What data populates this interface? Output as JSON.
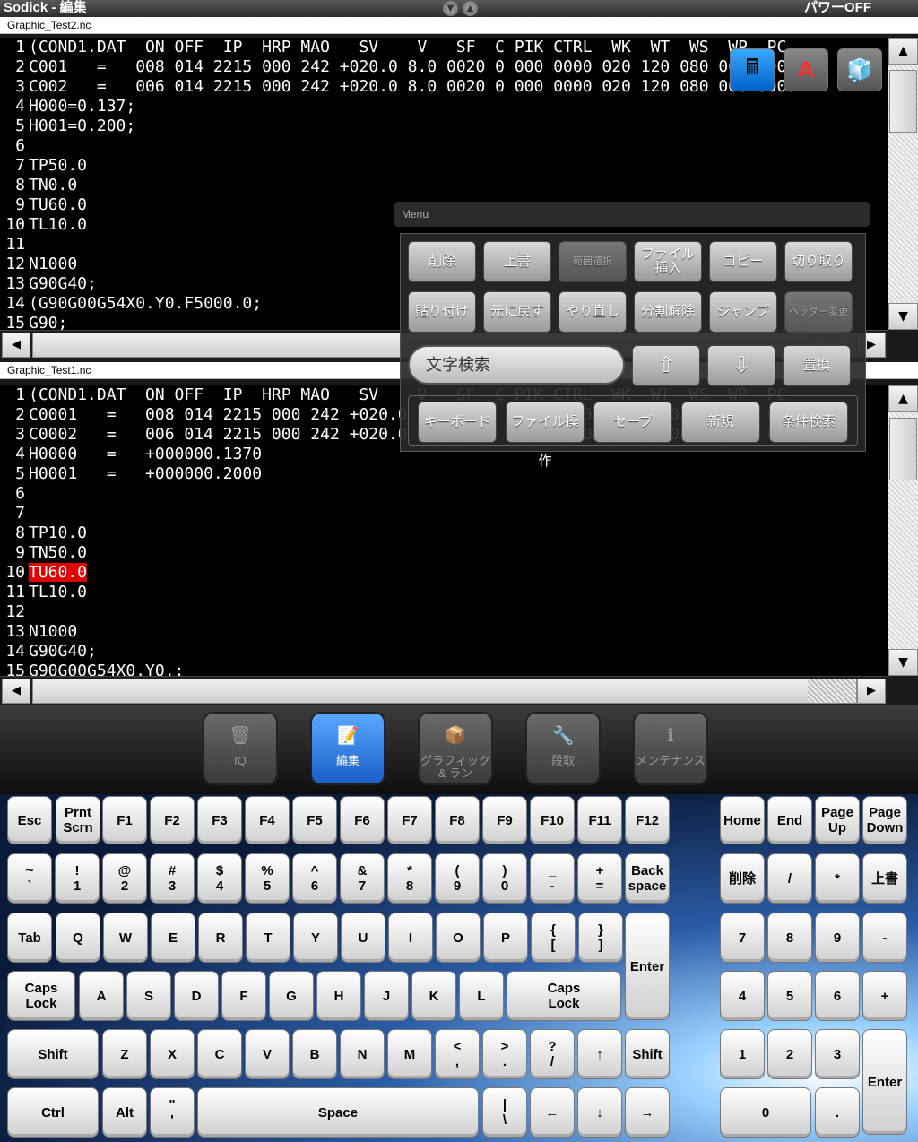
{
  "window": {
    "title": "Sodick - 編集",
    "power_status": "パワーOFF"
  },
  "editor_top": {
    "filename": "Graphic_Test2.nc",
    "line_numbers": [
      "1",
      "2",
      "3",
      "4",
      "5",
      "6",
      "7",
      "8",
      "9",
      "10",
      "11",
      "12",
      "13",
      "14",
      "15"
    ],
    "lines": [
      "(COND1.DAT  ON OFF  IP  HRP MAO   SV    V   SF  C PIK CTRL  WK  WT  WS  WP  PC",
      "C001   =   008 014 2215 000 242 +020.0 8.0 0020 0 000 0000 020 120 080 000 0000",
      "C002   =   006 014 2215 000 242 +020.0 8.0 0020 0 000 0000 020 120 080 000 0000",
      "H000=0.137;",
      "H001=0.200;",
      "",
      "TP50.0",
      "TN0.0",
      "TU60.0",
      "TL10.0",
      "",
      "N1000",
      "G90G40;",
      "(G90G00G54X0.Y0.F5000.0;",
      "G90;"
    ]
  },
  "editor_bottom": {
    "filename": "Graphic_Test1.nc",
    "line_numbers": [
      "1",
      "2",
      "3",
      "4",
      "5",
      "6",
      "7",
      "8",
      "9",
      "10",
      "11",
      "12",
      "13",
      "14",
      "15"
    ],
    "lines": [
      "(COND1.DAT  ON OFF  IP  HRP MAO   SV    V   SF  C PIK CTRL  WK  WT  WS  WP  PC",
      "C0001   =   008 014 2215 000 242 +020.0 8.0 0020 0 000 0000 020 120 080 000 0000",
      "C0002   =   006 014 2215 000 242 +020.0 8.0 0020 0 000 0000 020 120 080 000 0000",
      "H0000   =   +000000.1370",
      "H0001   =   +000000.2000",
      "",
      "",
      "TP10.0",
      "TN50.0",
      "TU60.0",
      "TL10.0",
      "",
      "N1000",
      "G90G40;",
      "G90G00G54X0.Y0.;"
    ],
    "highlighted_line": 10
  },
  "menu": {
    "title": "Menu",
    "row1": [
      "削除",
      "上書",
      "範囲選択",
      "ファイル挿入",
      "コピー",
      "切り取り"
    ],
    "row2": [
      "貼り付け",
      "元に戻す",
      "やり直し",
      "分割解除",
      "ジャンプ",
      "ヘッダー変更"
    ],
    "search_placeholder": "文字検索",
    "up_arrow": "⇧",
    "down_arrow": "⇩",
    "replace": "置換",
    "row4": [
      "キーボード",
      "ファイル操作",
      "セーブ",
      "新規",
      "条件検索"
    ]
  },
  "nav": [
    {
      "label": "IQ",
      "icon": "🗑"
    },
    {
      "label": "編集",
      "icon": "📝"
    },
    {
      "label": "グラフィック\n& ラン",
      "icon": "📦"
    },
    {
      "label": "段取",
      "icon": "🔧"
    },
    {
      "label": "メンテナンス",
      "icon": "ℹ"
    }
  ],
  "keyboard": {
    "row_f": [
      "Esc",
      "Prnt\nScrn",
      "F1",
      "F2",
      "F3",
      "F4",
      "F5",
      "F6",
      "F7",
      "F8",
      "F9",
      "F10",
      "F11",
      "F12"
    ],
    "row_nav": [
      "Home",
      "End",
      "Page\nUp",
      "Page\nDown"
    ],
    "row_num": [
      "~\n`",
      "!\n1",
      "@\n2",
      "#\n3",
      "$\n4",
      "%\n5",
      "^\n6",
      "&\n7",
      "*\n8",
      "(\n9",
      ")\n0",
      "_\n-",
      "+\n=",
      "Back\nspace"
    ],
    "row_num_pad1": [
      "削除",
      "/",
      "*",
      "上書"
    ],
    "row_q": [
      "Tab",
      "Q",
      "W",
      "E",
      "R",
      "T",
      "Y",
      "U",
      "I",
      "O",
      "P",
      "{\n[",
      "}\n]"
    ],
    "enter": "Enter",
    "row_q_pad": [
      "7",
      "8",
      "9",
      "-"
    ],
    "row_a": [
      "Caps\nLock",
      "A",
      "S",
      "D",
      "F",
      "G",
      "H",
      "J",
      "K",
      "L",
      "Caps\nLock"
    ],
    "row_a_pad": [
      "4",
      "5",
      "6",
      "+"
    ],
    "row_z": [
      "Shift",
      "Z",
      "X",
      "C",
      "V",
      "B",
      "N",
      "M",
      "<\n,",
      ">\n.",
      "?\n/",
      "↑",
      "Shift"
    ],
    "row_z_pad": [
      "1",
      "2",
      "3"
    ],
    "pad_enter": "Enter",
    "row_ctrl": [
      "Ctrl",
      "Alt",
      "\"\n'",
      "Space",
      "|\n\\",
      "←",
      "↓",
      "→"
    ],
    "row_ctrl_pad": [
      "0",
      "."
    ]
  }
}
